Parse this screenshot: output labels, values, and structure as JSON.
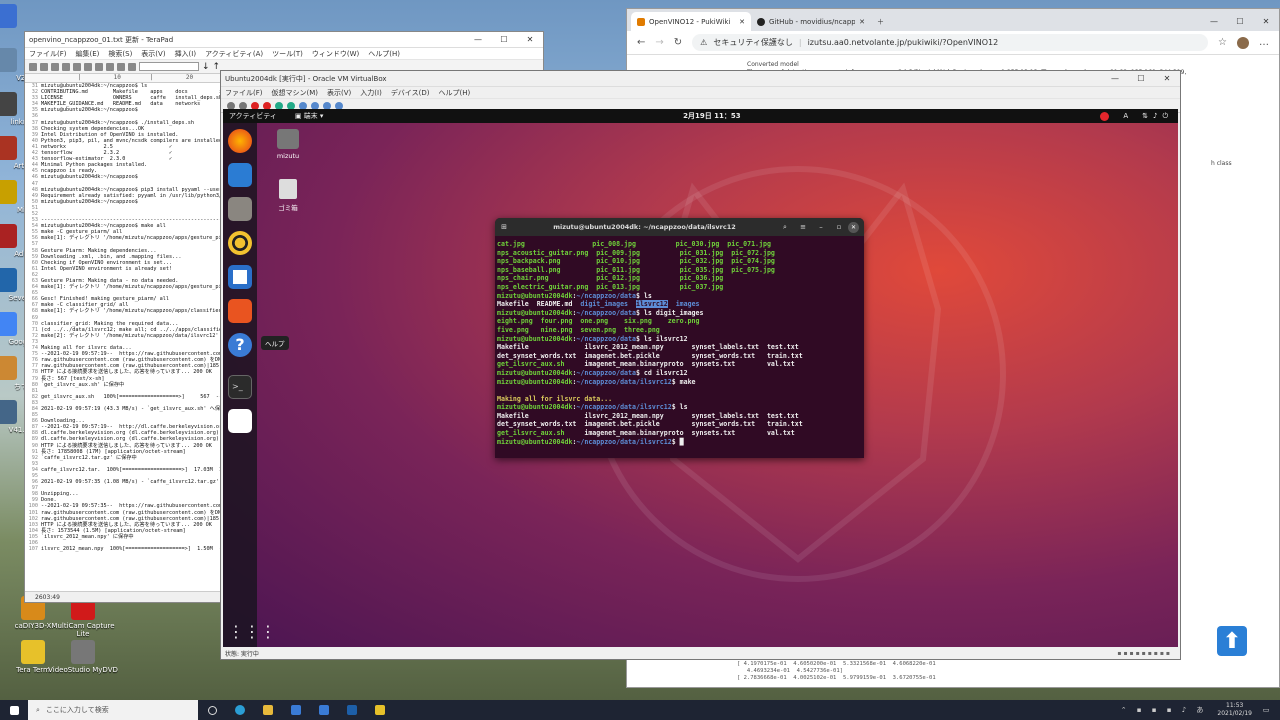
{
  "desktop": {
    "icons_left": [
      {
        "label": "",
        "color": "#3b6fd1"
      },
      {
        "label": "VZ",
        "color": "#6688aa"
      },
      {
        "label": "linkne",
        "color": "#444"
      },
      {
        "label": "Arty",
        "color": "#aa3322"
      },
      {
        "label": "Mi",
        "color": "#c8a000"
      },
      {
        "label": "Adb",
        "color": "#aa2222"
      },
      {
        "label": "Sevent",
        "color": "#2266aa"
      },
      {
        "label": "Google",
        "color": "#4285f4"
      },
      {
        "label": "ちて",
        "color": "#cc8833"
      },
      {
        "label": "V41.en",
        "color": "#446688"
      }
    ],
    "icons_bottom": [
      {
        "label": "caDIY3D-X",
        "color": "#d88a1a"
      },
      {
        "label": "MultiCam Capture Lite",
        "color": "#d11a1a"
      },
      {
        "label": "Tera Term",
        "color": "#e7c12a"
      },
      {
        "label": "VideoStudio MyDVD",
        "color": "#777"
      }
    ]
  },
  "editor": {
    "title": "openvino_ncappzoo_01.txt 更新 - TeraPad",
    "menus": [
      "ファイル(F)",
      "編集(E)",
      "検索(S)",
      "表示(V)",
      "挿入(I)",
      "アクティビティ(A)",
      "ツール(T)",
      "ウィンドウ(W)",
      "ヘルプ(H)"
    ],
    "ruler": "         |         10        |         20        |         30        |         40",
    "lines": [
      {
        "n": "31",
        "t": "mizutu@ubuntu2004dk:~/ncappzoo$ ls"
      },
      {
        "n": "32",
        "t": "CONTRIBUTING.md        Makefile    apps    docs          install.sh    ta"
      },
      {
        "n": "33",
        "t": "LICENSE                OWNERS      caffe   install_deps.sh  networks"
      },
      {
        "n": "34",
        "t": "MAKEFILE_GUIDANCE.md   README.md   data    networks"
      },
      {
        "n": "35",
        "t": "mizutu@ubuntu2004dk:~/ncappzoo$"
      },
      {
        "n": "36",
        "t": ""
      },
      {
        "n": "37",
        "t": "mizutu@ubuntu2004dk:~/ncappzoo$ ./install_deps.sh"
      },
      {
        "n": "38",
        "t": "Checking system dependencies...OK"
      },
      {
        "n": "39",
        "t": "Intel Distribution of OpenVINO is installed."
      },
      {
        "n": "40",
        "t": "Python3, pip3, pil, and mvnc/ncsdk compilers are installed."
      },
      {
        "n": "41",
        "t": "networkx            2.5                  ✓"
      },
      {
        "n": "42",
        "t": "tensorflow          2.3.2                ✓"
      },
      {
        "n": "43",
        "t": "tensorflow-estimator  2.3.0              ✓"
      },
      {
        "n": "44",
        "t": "Minimal Python packages installed."
      },
      {
        "n": "45",
        "t": "ncappzoo is ready."
      },
      {
        "n": "46",
        "t": "mizutu@ubuntu2004dk:~/ncappzoo$"
      },
      {
        "n": "47",
        "t": ""
      },
      {
        "n": "48",
        "t": "mizutu@ubuntu2004dk:~/ncappzoo$ pip3 install pyyaml --user"
      },
      {
        "n": "49",
        "t": "Requirement already satisfied: pyyaml in /usr/lib/python3/dist-packages"
      },
      {
        "n": "50",
        "t": "mizutu@ubuntu2004dk:~/ncappzoo$"
      },
      {
        "n": "51",
        "t": ""
      },
      {
        "n": "52",
        "t": ""
      },
      {
        "n": "53",
        "t": "--------------------------------------------------------------------------------"
      },
      {
        "n": "54",
        "t": "mizutu@ubuntu2004dk:~/ncappzoo$ make all"
      },
      {
        "n": "55",
        "t": "make -C gesture_piarm/ all"
      },
      {
        "n": "56",
        "t": "make[1]: ディレクトリ '/home/mizutu/ncappzoo/apps/gesture_piarm' に入ります"
      },
      {
        "n": "57",
        "t": ""
      },
      {
        "n": "58",
        "t": "Gesture Piarm: Making dependencies..."
      },
      {
        "n": "59",
        "t": "Downloading .xml, .bin, and .mapping files..."
      },
      {
        "n": "60",
        "t": "Checking if OpenVINO environment is set..."
      },
      {
        "n": "61",
        "t": "Intel OpenVINO environment is already set!"
      },
      {
        "n": "62",
        "t": ""
      },
      {
        "n": "63",
        "t": "Gesture Piarm: Making data - no data needed."
      },
      {
        "n": "64",
        "t": "make[1]: ディレクトリ '/home/mizutu/ncappzoo/apps/gesture_piarm' から出ます"
      },
      {
        "n": "65",
        "t": ""
      },
      {
        "n": "66",
        "t": "Gesc! Finished! making gesture_piarm/ all"
      },
      {
        "n": "67",
        "t": "make -C classifier_grid/ all"
      },
      {
        "n": "68",
        "t": "make[1]: ディレクトリ '/home/mizutu/ncappzoo/apps/classifier_grid'"
      },
      {
        "n": "69",
        "t": ""
      },
      {
        "n": "70",
        "t": "classifier_grid: Making the required data..."
      },
      {
        "n": "71",
        "t": "(cd ../../data/ilsvrc12; make all; cd ../../apps/classifier_grid)"
      },
      {
        "n": "72",
        "t": "make[2]: ディレクトリ '/home/mizutu/ncappzoo/data/ilsvrc12'"
      },
      {
        "n": "73",
        "t": ""
      },
      {
        "n": "74",
        "t": "Making all for ilsvrc data..."
      },
      {
        "n": "75",
        "t": "--2021-02-19 09:57:19--  https://raw.githubusercontent.com/"
      },
      {
        "n": "76",
        "t": "raw.githubusercontent.com (raw.githubusercontent.com) をDNSに問い合わせています"
      },
      {
        "n": "77",
        "t": "raw.githubusercontent.com (raw.githubusercontent.com)|185.199.108.133|:443"
      },
      {
        "n": "78",
        "t": "HTTP による接続要求を送信しました、応答を待っています... 200 OK"
      },
      {
        "n": "79",
        "t": "長さ: 567 [text/x-sh]"
      },
      {
        "n": "80",
        "t": "`get_ilsvrc_aux.sh' に保存中"
      },
      {
        "n": "81",
        "t": ""
      },
      {
        "n": "82",
        "t": "get_ilsvrc_aux.sh   100%[===================>]     567  --.-KB/s"
      },
      {
        "n": "83",
        "t": ""
      },
      {
        "n": "84",
        "t": "2021-02-19 09:57:19 (43.3 MB/s) - `get_ilsvrc_aux.sh' へ保存完了"
      },
      {
        "n": "85",
        "t": ""
      },
      {
        "n": "86",
        "t": "Downloading..."
      },
      {
        "n": "87",
        "t": "--2021-02-19 09:57:19--  http://dl.caffe.berkeleyvision.org/caffe_ilsvrc12.tar.gz"
      },
      {
        "n": "88",
        "t": "dl.caffe.berkeleyvision.org (dl.caffe.berkeleyvision.org) をDNSに問い合わせています"
      },
      {
        "n": "89",
        "t": "dl.caffe.berkeleyvision.org (dl.caffe.berkeleyvision.org)|169.229.222.251|:80"
      },
      {
        "n": "90",
        "t": "HTTP による接続要求を送信しました、応答を待っています... 200 OK"
      },
      {
        "n": "91",
        "t": "長さ: 17858008 (17M) [application/octet-stream]"
      },
      {
        "n": "92",
        "t": "`caffe_ilsvrc12.tar.gz' に保存中"
      },
      {
        "n": "93",
        "t": ""
      },
      {
        "n": "94",
        "t": "caffe_ilsvrc12.tar.  100%[===================>]  17.03M  1.09MB/s"
      },
      {
        "n": "95",
        "t": ""
      },
      {
        "n": "96",
        "t": "2021-02-19 09:57:35 (1.08 MB/s) - `caffe_ilsvrc12.tar.gz' へ保存完了"
      },
      {
        "n": "97",
        "t": ""
      },
      {
        "n": "98",
        "t": "Unzipping..."
      },
      {
        "n": "99",
        "t": "Done."
      },
      {
        "n": "100",
        "t": "--2021-02-19 09:57:35--  https://raw.githubusercontent.com/"
      },
      {
        "n": "101",
        "t": "raw.githubusercontent.com (raw.githubusercontent.com) をDNSに問い合わせています"
      },
      {
        "n": "102",
        "t": "raw.githubusercontent.com (raw.githubusercontent.com)|185.199.108.133|"
      },
      {
        "n": "103",
        "t": "HTTP による接続要求を送信しました、応答を待っています... 200 OK"
      },
      {
        "n": "104",
        "t": "長さ: 1573544 (1.5M) [application/octet-stream]"
      },
      {
        "n": "105",
        "t": "`ilsvrc_2012_mean.npy' に保存中"
      },
      {
        "n": "106",
        "t": ""
      },
      {
        "n": "107",
        "t": "ilsvrc_2012_mean.npy  100%[===================>]  1.50M  --.-KB/s"
      }
    ],
    "status_pos": "2603:49",
    "status_mode": "挿入",
    "status_changed": "変更"
  },
  "browser": {
    "tabs": [
      {
        "label": "OpenVINO12 - PukiWiki",
        "active": true
      },
      {
        "label": "GitHub - movidius/ncappzoo: C...",
        "active": false
      }
    ],
    "security": "セキュリティ保護なし",
    "url": "izutsu.aa0.netvolante.jp/pukiwiki/?OpenVINO12",
    "content_lines": [
      "Converted model",
      "The array of detection summary info, name - conv2d_3/BiasAdd/YoloRegion, shape - 1,255,13,13. The anchor values are 81,82, 135,169, 344,319,"
    ],
    "side_text": "h class",
    "bottom_lines": [
      "[ 4.1970175e-01  4.6050200e-01  5.3321568e-01  4.6068220e-01",
      "   4.4693234e-01  4.5427736e-01]",
      "[ 2.7836668e-01  4.0025102e-01  5.9799159e-01  3.6720755e-01"
    ]
  },
  "vm": {
    "title": "Ubuntu2004dk [実行中] - Oracle VM VirtualBox",
    "menus": [
      "ファイル(F)",
      "仮想マシン(M)",
      "表示(V)",
      "入力(I)",
      "デバイス(D)",
      "ヘルプ(H)"
    ],
    "status": "状態: 実行中"
  },
  "ubuntu": {
    "activities": "アクティビティ",
    "app_menu": "端末",
    "clock": "2月19日  11：53",
    "input_method": "A",
    "tooltip": "ヘルプ",
    "desktop_icons": [
      {
        "label": "mizutu"
      },
      {
        "label": "ゴミ箱"
      }
    ]
  },
  "terminal": {
    "title": "mizutu@ubuntu2004dk: ~/ncappzoo/data/ilsvrc12",
    "lines": [
      [
        {
          "c": "tg",
          "t": "cat.jpg              "
        },
        {
          "c": "tg",
          "t": "   pic_008.jpg          pic_030.jpg  pic_071.jpg"
        }
      ],
      [
        {
          "c": "tg",
          "t": "nps_acoustic_guitar.png  pic_009.jpg          pic_031.jpg  pic_072.jpg"
        }
      ],
      [
        {
          "c": "tg",
          "t": "nps_backpack.png         pic_010.jpg          pic_032.jpg  pic_074.jpg"
        }
      ],
      [
        {
          "c": "tg",
          "t": "nps_baseball.png         pic_011.jpg          pic_035.jpg  pic_075.jpg"
        }
      ],
      [
        {
          "c": "tg",
          "t": "nps_chair.png            pic_012.jpg          pic_036.jpg"
        }
      ],
      [
        {
          "c": "tg",
          "t": "nps_electric_guitar.png  pic_013.jpg          pic_037.jpg"
        }
      ],
      [
        {
          "c": "tg",
          "t": "mizutu@ubuntu2004dk"
        },
        {
          "c": "tw",
          "t": ":"
        },
        {
          "c": "tb2",
          "t": "~/ncappzoo/data"
        },
        {
          "c": "tw",
          "t": "$ ls"
        }
      ],
      [
        {
          "c": "tw",
          "t": "Makefile  README.md  "
        },
        {
          "c": "tb2",
          "t": "digit_images"
        },
        {
          "c": "tw",
          "t": "  "
        },
        {
          "c": "th",
          "t": "ilsvrc12"
        },
        {
          "c": "tw",
          "t": "  "
        },
        {
          "c": "tb2",
          "t": "images"
        }
      ],
      [
        {
          "c": "tg",
          "t": "mizutu@ubuntu2004dk"
        },
        {
          "c": "tw",
          "t": ":"
        },
        {
          "c": "tb2",
          "t": "~/ncappzoo/data"
        },
        {
          "c": "tw",
          "t": "$ ls digit_images"
        }
      ],
      [
        {
          "c": "tg",
          "t": "eight.png  four.png  one.png    six.png    zero.png"
        }
      ],
      [
        {
          "c": "tg",
          "t": "five.png   nine.png  seven.png  three.png"
        }
      ],
      [
        {
          "c": "tg",
          "t": "mizutu@ubuntu2004dk"
        },
        {
          "c": "tw",
          "t": ":"
        },
        {
          "c": "tb2",
          "t": "~/ncappzoo/data"
        },
        {
          "c": "tw",
          "t": "$ ls ilsvrc12"
        }
      ],
      [
        {
          "c": "tw",
          "t": "Makefile              ilsvrc_2012_mean.npy       synset_labels.txt  test.txt"
        }
      ],
      [
        {
          "c": "tw",
          "t": "det_synset_words.txt  imagenet.bet.pickle        synset_words.txt   train.txt"
        }
      ],
      [
        {
          "c": "tg",
          "t": "get_ilsvrc_aux.sh"
        },
        {
          "c": "tw",
          "t": "     imagenet_mean.binaryproto  synsets.txt        val.txt"
        }
      ],
      [
        {
          "c": "tg",
          "t": "mizutu@ubuntu2004dk"
        },
        {
          "c": "tw",
          "t": ":"
        },
        {
          "c": "tb2",
          "t": "~/ncappzoo/data"
        },
        {
          "c": "tw",
          "t": "$ cd ilsvrc12"
        }
      ],
      [
        {
          "c": "tg",
          "t": "mizutu@ubuntu2004dk"
        },
        {
          "c": "tw",
          "t": ":"
        },
        {
          "c": "tb2",
          "t": "~/ncappzoo/data/ilsvrc12"
        },
        {
          "c": "tw",
          "t": "$ make"
        }
      ],
      [
        {
          "c": "tw",
          "t": ""
        }
      ],
      [
        {
          "c": "ty",
          "t": "Making all for ilsvrc data..."
        }
      ],
      [
        {
          "c": "tg",
          "t": "mizutu@ubuntu2004dk"
        },
        {
          "c": "tw",
          "t": ":"
        },
        {
          "c": "tb2",
          "t": "~/ncappzoo/data/ilsvrc12"
        },
        {
          "c": "tw",
          "t": "$ ls"
        }
      ],
      [
        {
          "c": "tw",
          "t": "Makefile              ilsvrc_2012_mean.npy       synset_labels.txt  test.txt"
        }
      ],
      [
        {
          "c": "tw",
          "t": "det_synset_words.txt  imagenet.bet.pickle        synset_words.txt   train.txt"
        }
      ],
      [
        {
          "c": "tg",
          "t": "get_ilsvrc_aux.sh"
        },
        {
          "c": "tw",
          "t": "     imagenet_mean.binaryproto  synsets.txt        val.txt"
        }
      ],
      [
        {
          "c": "tg",
          "t": "mizutu@ubuntu2004dk"
        },
        {
          "c": "tw",
          "t": ":"
        },
        {
          "c": "tb2",
          "t": "~/ncappzoo/data/ilsvrc12"
        },
        {
          "c": "tw",
          "t": "$ █"
        }
      ]
    ]
  },
  "taskbar": {
    "search_placeholder": "ここに入力して検索",
    "time": "11:53",
    "date": "2021/02/19"
  }
}
